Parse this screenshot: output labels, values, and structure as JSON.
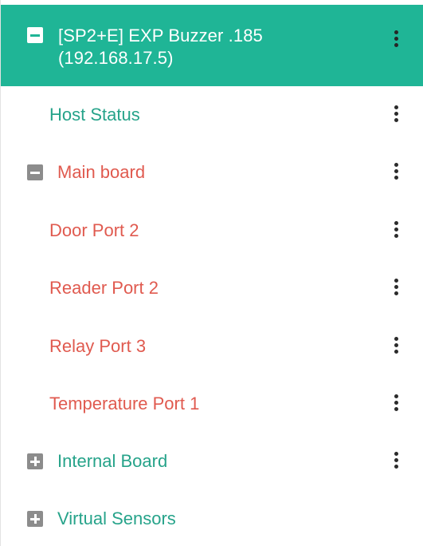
{
  "colors": {
    "accent_teal": "#1fb596",
    "teal_text": "#26a38a",
    "red_text": "#e05a4f",
    "expander_gray": "#8c8c8c"
  },
  "header": {
    "title_line1": "[SP2+E] EXP Buzzer .185",
    "title_line2": "(192.168.17.5)",
    "expanded": true
  },
  "items": [
    {
      "label": "Host Status",
      "color": "teal",
      "expander": "none"
    },
    {
      "label": "Main board",
      "color": "red",
      "expander": "minus"
    },
    {
      "label": "Door Port 2",
      "color": "red",
      "expander": "none"
    },
    {
      "label": "Reader Port 2",
      "color": "red",
      "expander": "none"
    },
    {
      "label": "Relay Port 3",
      "color": "red",
      "expander": "none"
    },
    {
      "label": "Temperature Port 1",
      "color": "red",
      "expander": "none"
    },
    {
      "label": "Internal Board",
      "color": "teal",
      "expander": "plus"
    },
    {
      "label": "Virtual Sensors",
      "color": "teal",
      "expander": "plus"
    }
  ],
  "icons": {
    "header_toggle": "collapse-minus-icon",
    "row_menu": "kebab-menu-icon",
    "expand": "expand-plus-icon",
    "collapse": "collapse-minus-icon"
  }
}
